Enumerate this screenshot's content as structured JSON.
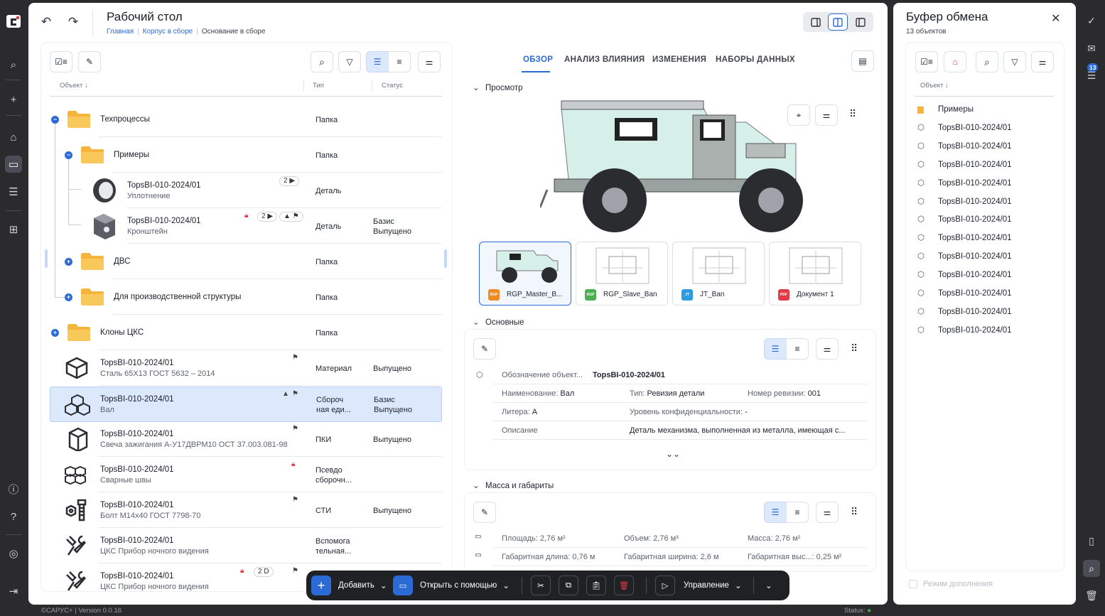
{
  "app": {
    "title": "Рабочий стол",
    "breadcrumbs": [
      "Главная",
      "Корпус в сборе",
      "Основание в сборе"
    ],
    "footer_left": "©САРУС+",
    "footer_version": "Version 0.0.16",
    "footer_status": "Status: "
  },
  "tree": {
    "columns": {
      "object": "Объект ↓",
      "type": "Тип",
      "status": "Статус"
    },
    "rows": [
      {
        "name": "Техпроцессы",
        "type": "Папка"
      },
      {
        "name": "Примеры",
        "type": "Папка"
      },
      {
        "name": "TopsBI-010-2024/01",
        "sub": "Уплотнение",
        "type": "Деталь",
        "badge": "2 ▶"
      },
      {
        "name": "TopsBI-010-2024/01",
        "sub": "Кронштейн",
        "type": "Деталь",
        "status": "Базис\nВыпущено",
        "badge": "2 ▶"
      },
      {
        "name": "ДВС",
        "type": "Папка"
      },
      {
        "name": "Для производственной структуры",
        "type": "Папка"
      },
      {
        "name": "Клоны ЦКС",
        "type": "Папка"
      },
      {
        "name": "TopsBI-010-2024/01",
        "sub": "Сталь 65Х13 ГОСТ 5632 – 2014",
        "type": "Материал",
        "status": "Выпущено"
      },
      {
        "name": "TopsBI-010-2024/01",
        "sub": "Вал",
        "type": "Сбороч\nная еди...",
        "status": "Базис\nВыпущено"
      },
      {
        "name": "TopsBI-010-2024/01",
        "sub": "Свеча зажигания А-У17ДВРМ10 ОСТ 37.003.081-98",
        "type": "ПКИ",
        "status": "Выпущено"
      },
      {
        "name": "TopsBI-010-2024/01",
        "sub": "Сварные швы",
        "type": "Псевдо\nсборочн..."
      },
      {
        "name": "TopsBI-010-2024/01",
        "sub": "Болт М14х40 ГОСТ 7798-70",
        "type": "СТИ",
        "status": "Выпущено"
      },
      {
        "name": "TopsBI-010-2024/01",
        "sub": "ЦКС Прибор ночного видения",
        "type": "Вспомога\nтельная..."
      },
      {
        "name": "TopsBI-010-2024/01",
        "sub": "ЦКС Прибор ночного видения",
        "badge": "2 D"
      }
    ]
  },
  "tabs": [
    "ОБЗОР",
    "АНАЛИЗ ВЛИЯНИЯ",
    "ИЗМЕНЕНИЯ",
    "НАБОРЫ ДАННЫХ"
  ],
  "preview": {
    "section_title": "Просмотр",
    "thumbnails": [
      {
        "name": "RGP_Master_B...",
        "type": "RGP",
        "color": "#f08a24"
      },
      {
        "name": "RGP_Slave_Ban",
        "type": "RGP",
        "color": "#4caf50"
      },
      {
        "name": "JT_Ban",
        "type": "JT",
        "color": "#2c9be0"
      },
      {
        "name": "Документ 1",
        "type": "PDF",
        "color": "#e23b45"
      }
    ]
  },
  "basic": {
    "section_title": "Основные",
    "designation_label": "Обозначение объект...",
    "designation_value": "TopsBI-010-2024/01",
    "name_label": "Наименование:",
    "name_value": "Вал",
    "type_label": "Тип:",
    "type_value": "Ревизия детали",
    "rev_label": "Номер ревизии:",
    "rev_value": "001",
    "lit_label": "Литера:",
    "lit_value": "А",
    "conf_label": "Уровень конфиденциальности:",
    "conf_value": "-",
    "desc_label": "Описание",
    "desc_value": "Деталь механизма, выполненная из металла, имеющая с..."
  },
  "mass": {
    "section_title": "Масса и габариты",
    "area": "Площадь: 2,76 м²",
    "volume": "Объем: 2,76 м³",
    "mass": "Масса: 2,76 м²",
    "length": "Габаритная длина: 0,76 м",
    "width": "Габаритная ширина: 2,6 м",
    "height": "Габаритная выс...: 0,25 м²"
  },
  "toolbar": {
    "add": "Добавить",
    "open_with": "Открыть с помощью",
    "manage": "Управление"
  },
  "clipboard": {
    "title": "Буфер обмена",
    "count": "13 объектов",
    "column": "Объект ↓",
    "items": [
      "Примеры",
      "TopsBI-010-2024/01",
      "TopsBI-010-2024/01",
      "TopsBI-010-2024/01",
      "TopsBI-010-2024/01",
      "TopsBI-010-2024/01",
      "TopsBI-010-2024/01",
      "TopsBI-010-2024/01",
      "TopsBI-010-2024/01",
      "TopsBI-010-2024/01",
      "TopsBI-010-2024/01",
      "TopsBI-010-2024/01",
      "TopsBI-010-2024/01"
    ],
    "mode_label": "Режим дополнения"
  },
  "rightrail": {
    "notif_count": "13"
  },
  "colors": {
    "accent": "#2c6bd6",
    "danger": "#e23b45",
    "folder": "#f5b53d",
    "rail": "#2b2b2d"
  }
}
